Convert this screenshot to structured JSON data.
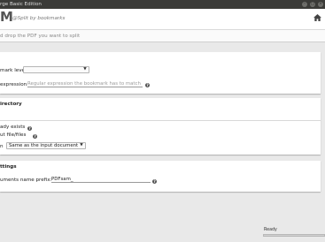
{
  "window": {
    "title": "rge Basic Edition"
  },
  "header": {
    "logo": "M",
    "tagline": "@Split by bookmarks"
  },
  "dropzone": {
    "placeholder": "d drop the PDF you want to split"
  },
  "split_settings": {
    "bookmark_level_label": "mark level:",
    "bookmark_level_value": "",
    "regex_label": "expression:",
    "regex_placeholder": "Regular expression the bookmark has to match",
    "help": "?"
  },
  "destination": {
    "title": "irectory",
    "overwrite_label": "ady exists",
    "compress_label": "ut file/files",
    "version_label": "n",
    "version_value": "Same as the input document",
    "help": "?"
  },
  "advanced": {
    "title": "ttings",
    "prefix_label": "uments name prefix:",
    "prefix_value": "PDFsam_",
    "help": "?"
  },
  "status": {
    "text": "Ready",
    "progress": 0
  }
}
